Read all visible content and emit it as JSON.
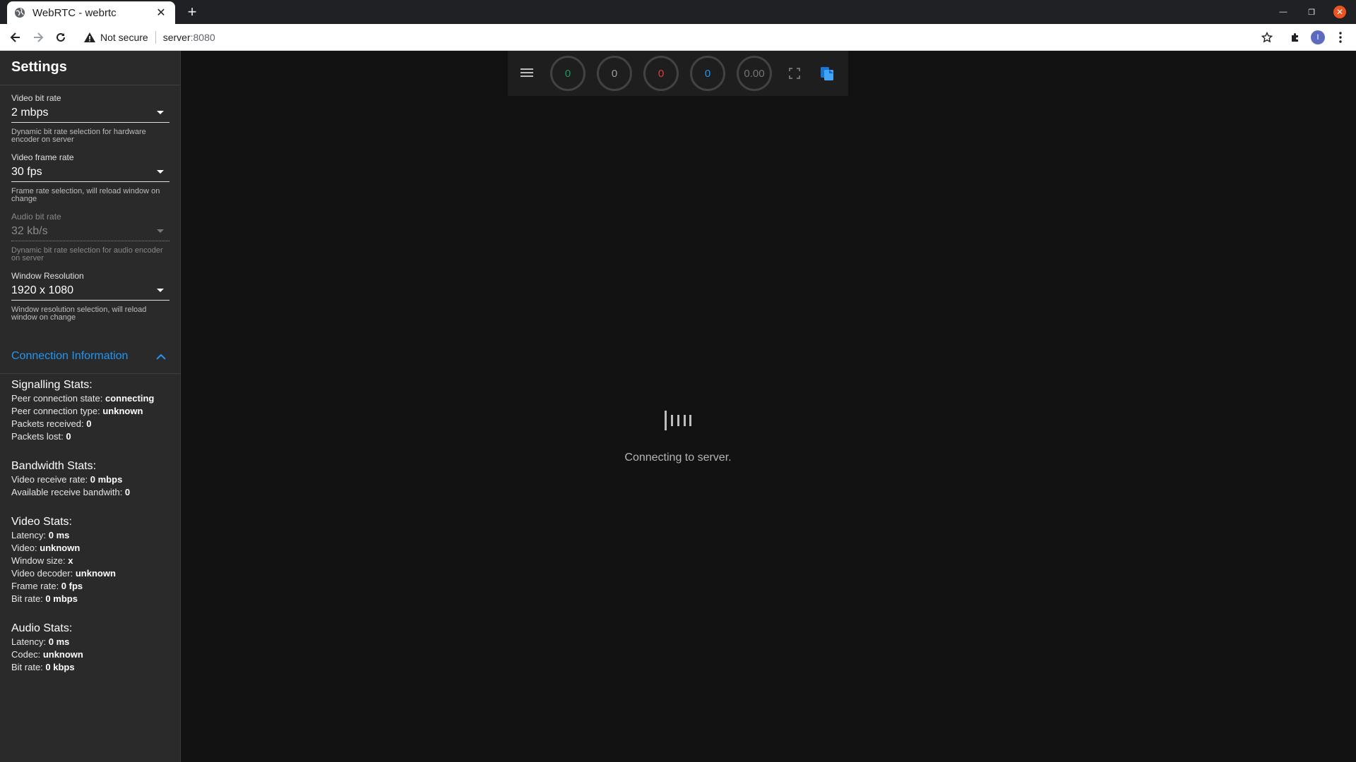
{
  "browser": {
    "tab_title": "WebRTC - webrtc",
    "security_label": "Not secure",
    "url_host": "server",
    "url_port": ":8080",
    "profile_initial": "I"
  },
  "sidebar": {
    "title": "Settings",
    "fields": [
      {
        "label": "Video bit rate",
        "value": "2 mbps",
        "hint": "Dynamic bit rate selection for hardware encoder on server",
        "disabled": false
      },
      {
        "label": "Video frame rate",
        "value": "30 fps",
        "hint": "Frame rate selection, will reload window on change",
        "disabled": false
      },
      {
        "label": "Audio bit rate",
        "value": "32 kb/s",
        "hint": "Dynamic bit rate selection for audio encoder on server",
        "disabled": true
      },
      {
        "label": "Window Resolution",
        "value": "1920 x 1080",
        "hint": "Window resolution selection, will reload window on change",
        "disabled": false
      }
    ],
    "connection_info_label": "Connection Information",
    "signalling": {
      "heading": "Signalling Stats:",
      "rows": [
        {
          "label": "Peer connection state: ",
          "value": "connecting"
        },
        {
          "label": "Peer connection type: ",
          "value": "unknown"
        },
        {
          "label": "Packets received: ",
          "value": "0"
        },
        {
          "label": "Packets lost: ",
          "value": "0"
        }
      ]
    },
    "bandwidth": {
      "heading": "Bandwidth Stats:",
      "rows": [
        {
          "label": "Video receive rate: ",
          "value": "0 mbps"
        },
        {
          "label": "Available receive bandwith: ",
          "value": "0"
        }
      ]
    },
    "video": {
      "heading": "Video Stats:",
      "rows": [
        {
          "label": "Latency: ",
          "value": "0 ms"
        },
        {
          "label": "Video: ",
          "value": "unknown"
        },
        {
          "label": "Window size: ",
          "value": "x"
        },
        {
          "label": "Video decoder: ",
          "value": "unknown"
        },
        {
          "label": "Frame rate: ",
          "value": "0 fps"
        },
        {
          "label": "Bit rate: ",
          "value": "0 mbps"
        }
      ]
    },
    "audio": {
      "heading": "Audio Stats:",
      "rows": [
        {
          "label": "Latency: ",
          "value": "0 ms"
        },
        {
          "label": "Codec: ",
          "value": "unknown"
        },
        {
          "label": "Bit rate: ",
          "value": "0 kbps"
        }
      ]
    }
  },
  "controls": {
    "gauges": [
      {
        "value": "0",
        "color": "#1b9a59"
      },
      {
        "value": "0",
        "color": "#9e9e9e"
      },
      {
        "value": "0",
        "color": "#e53935"
      },
      {
        "value": "0",
        "color": "#2196f3"
      },
      {
        "value": "0.00",
        "color": "#757575"
      }
    ]
  },
  "main": {
    "status": "Connecting to server."
  },
  "colors": {
    "accent": "#2196f3",
    "sidebar_bg": "#2a2a2a",
    "page_bg": "#121212"
  }
}
